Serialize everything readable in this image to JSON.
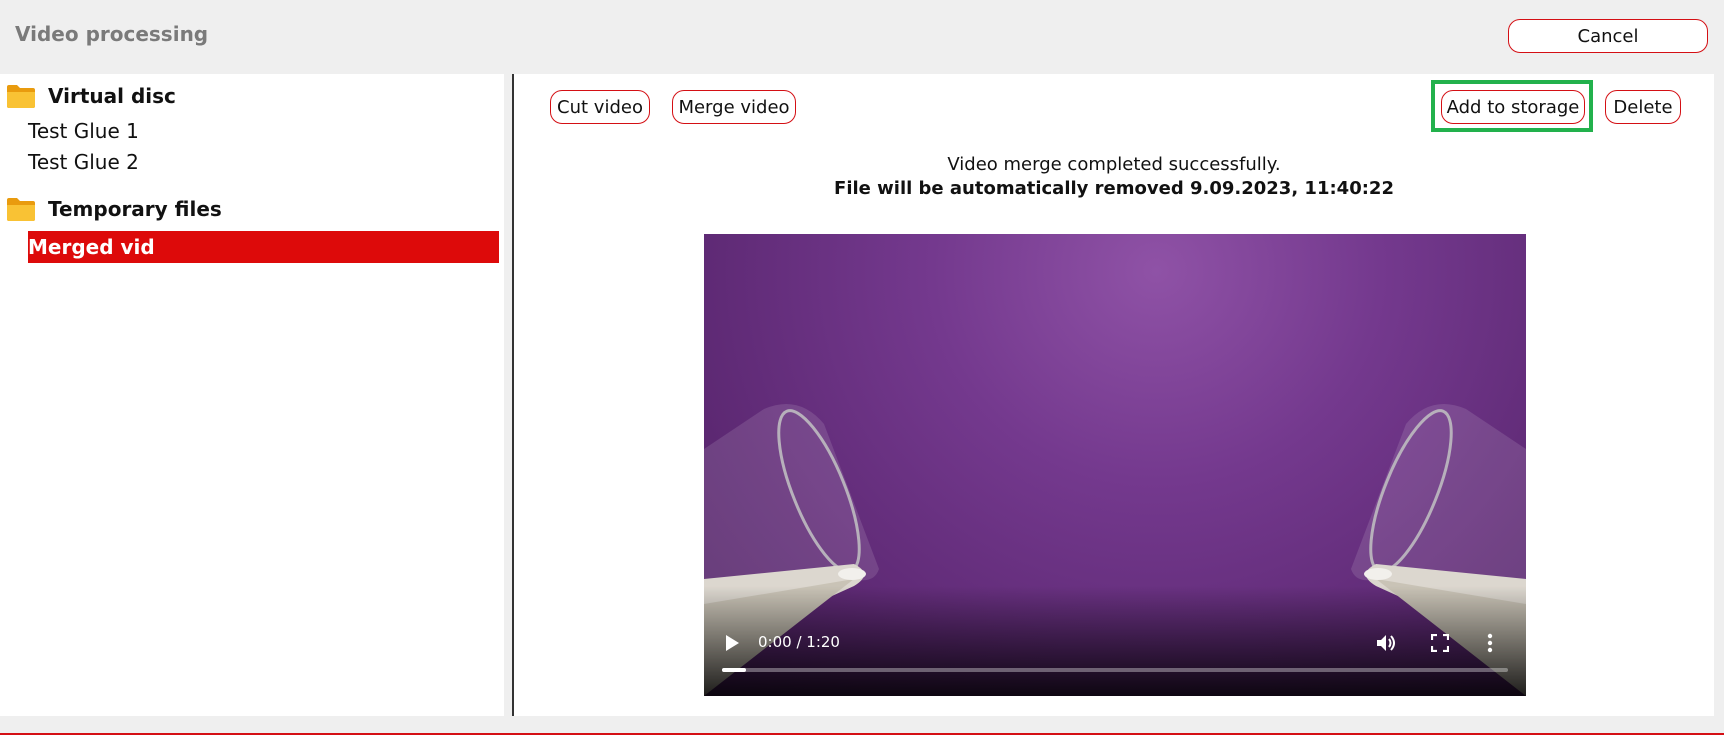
{
  "header": {
    "title": "Video processing",
    "cancel_label": "Cancel"
  },
  "tree": {
    "folders": [
      {
        "label": "Virtual disc",
        "items": [
          "Test Glue 1",
          "Test Glue 2"
        ]
      },
      {
        "label": "Temporary files",
        "items": [
          "Merged vid"
        ]
      }
    ],
    "selected_item": "Merged vid"
  },
  "toolbar": {
    "cut_label": "Cut video",
    "merge_label": "Merge video",
    "add_storage_label": "Add to storage",
    "delete_label": "Delete"
  },
  "status": {
    "message": "Video merge completed successfully.",
    "removal_notice": "File will be automatically removed 9.09.2023, 11:40:22"
  },
  "player": {
    "time": "0:00 / 1:20",
    "progress": 0.03
  },
  "colors": {
    "accent": "#d40f14",
    "selected_bg": "#dd0a0a",
    "highlight": "#22b14c",
    "folder": "#f5b324"
  },
  "icons": {
    "folder": "folder-icon",
    "play": "play-icon",
    "volume": "volume-icon",
    "fullscreen": "fullscreen-icon",
    "more": "more-options-icon"
  }
}
